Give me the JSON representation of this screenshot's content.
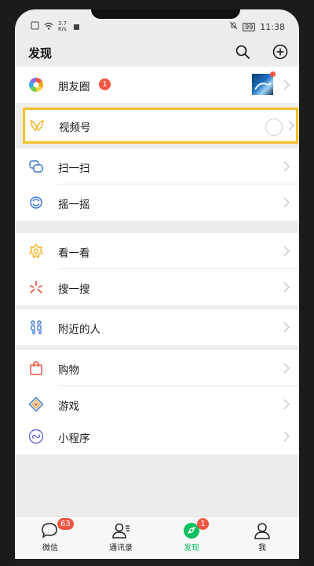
{
  "status_bar": {
    "speed": "3.7 K/s",
    "time": "11:38",
    "battery": "99"
  },
  "header": {
    "title": "发现",
    "search_icon": "search-icon",
    "add_icon": "plus-circle-icon"
  },
  "menu": [
    {
      "id": "moments",
      "label": "朋友圈",
      "icon": "moments-icon",
      "badge": "1"
    },
    {
      "id": "channels",
      "label": "视频号",
      "icon": "channels-icon"
    },
    {
      "id": "scan",
      "label": "扫一扫",
      "icon": "scan-icon"
    },
    {
      "id": "shake",
      "label": "摇一摇",
      "icon": "shake-icon"
    },
    {
      "id": "top-stories",
      "label": "看一看",
      "icon": "top-stories-icon"
    },
    {
      "id": "search",
      "label": "搜一搜",
      "icon": "search-feature-icon"
    },
    {
      "id": "nearby",
      "label": "附近的人",
      "icon": "people-nearby-icon"
    },
    {
      "id": "shopping",
      "label": "购物",
      "icon": "shopping-bag-icon"
    },
    {
      "id": "games",
      "label": "游戏",
      "icon": "games-icon"
    },
    {
      "id": "mini-programs",
      "label": "小程序",
      "icon": "mini-programs-icon"
    }
  ],
  "tabs": [
    {
      "label": "微信",
      "badge": "63",
      "icon": "chat-icon"
    },
    {
      "label": "通讯录",
      "icon": "contacts-icon"
    },
    {
      "label": "发现",
      "badge": "1",
      "icon": "discover-icon",
      "active": true
    },
    {
      "label": "我",
      "icon": "me-icon"
    }
  ],
  "colors": {
    "accent": "#07c160",
    "badge": "#f25542",
    "highlight": "#f5c02a"
  }
}
